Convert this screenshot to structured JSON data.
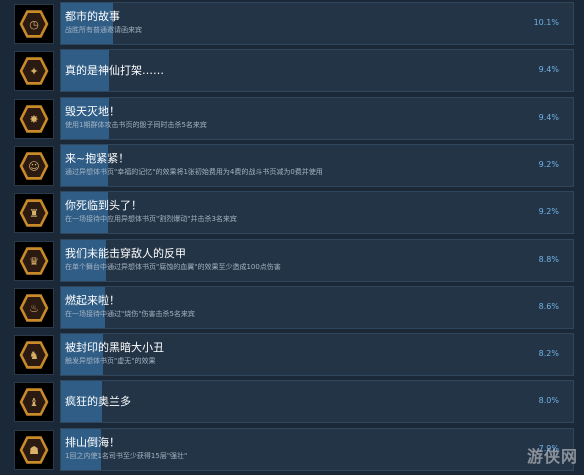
{
  "achievements": [
    {
      "title": "都市的故事",
      "description": "战胜所有普通邀请函来宾",
      "percent": "10.1%",
      "fill": 0.101,
      "icon": "golden-clock-icon"
    },
    {
      "title": "真的是神仙打架……",
      "description": "",
      "percent": "9.4%",
      "fill": 0.094,
      "icon": "red-sign-icon"
    },
    {
      "title": "毁天灭地！",
      "description": "使用1期群体攻击书页的骰子同时击杀5名来宾",
      "percent": "9.4%",
      "fill": 0.094,
      "icon": "explosion-icon"
    },
    {
      "title": "来~抱紧紧！",
      "description": "通过异想体书页\"幸福的记忆\"的效果将1张初始费用为4费的战斗书页减为0费并使用",
      "percent": "9.2%",
      "fill": 0.092,
      "icon": "character-portrait-icon"
    },
    {
      "title": "你死临到头了！",
      "description": "在一场接待中应用异想体书页\"割烈爆动\"并击杀3名来宾",
      "percent": "9.2%",
      "fill": 0.092,
      "icon": "suited-figure-icon"
    },
    {
      "title": "我们未能击穿敌人的反甲",
      "description": "在单个舞台中通过异想体书页\"腐蚀的血翼\"的效果至少造成100点伤害",
      "percent": "8.8%",
      "fill": 0.088,
      "icon": "long-hair-figure-icon"
    },
    {
      "title": "燃起来啦！",
      "description": "在一场接待中通过\"烧伤\"伤害击杀5名来宾",
      "percent": "8.6%",
      "fill": 0.086,
      "icon": "flame-weapon-icon"
    },
    {
      "title": "被封印的黑暗大小丑",
      "description": "触发异想体书页\"虚无\"的效果",
      "percent": "8.2%",
      "fill": 0.082,
      "icon": "jester-icon"
    },
    {
      "title": "疯狂的奥兰多",
      "description": "",
      "percent": "8.0%",
      "fill": 0.08,
      "icon": "orlando-icon"
    },
    {
      "title": "排山倒海！",
      "description": "1回之内使1名司书至少获得15层\"强壮\"",
      "percent": "7.9%",
      "fill": 0.079,
      "icon": "hooded-figure-icon"
    }
  ],
  "watermark": "游侠网"
}
